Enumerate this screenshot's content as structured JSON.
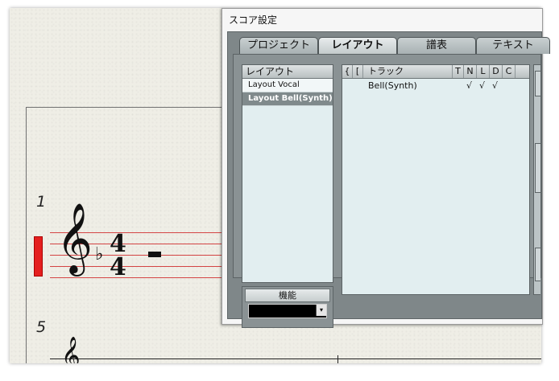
{
  "dialog": {
    "title": "スコア設定",
    "tabs": [
      {
        "label": "プロジェクト",
        "active": false
      },
      {
        "label": "レイアウト",
        "active": true
      },
      {
        "label": "譜表",
        "active": false
      },
      {
        "label": "テキスト",
        "active": false
      }
    ],
    "layout_panel": {
      "header": "レイアウト",
      "items": [
        "Layout Vocal",
        "Layout Bell(Synth)"
      ],
      "selected_index": 1
    },
    "function": {
      "label": "機能",
      "selected_value": ""
    },
    "track_table": {
      "columns": [
        "{",
        "[",
        "トラック",
        "T",
        "N",
        "L",
        "D",
        "C"
      ],
      "rows": [
        {
          "brace": "",
          "bracket": "",
          "track": "Bell(Synth)",
          "T": "",
          "N": "√",
          "L": "√",
          "D": "√",
          "C": ""
        }
      ]
    }
  },
  "score": {
    "measure_numbers": [
      "1",
      "5"
    ],
    "key_signature": "♭",
    "time_signature": {
      "top": "4",
      "bottom": "4"
    },
    "clef_glyph": "𝄞",
    "track_marker_color": "#e41f1f",
    "staff_line_color": "#d44444"
  },
  "icons": {
    "dropdown": "▾"
  }
}
